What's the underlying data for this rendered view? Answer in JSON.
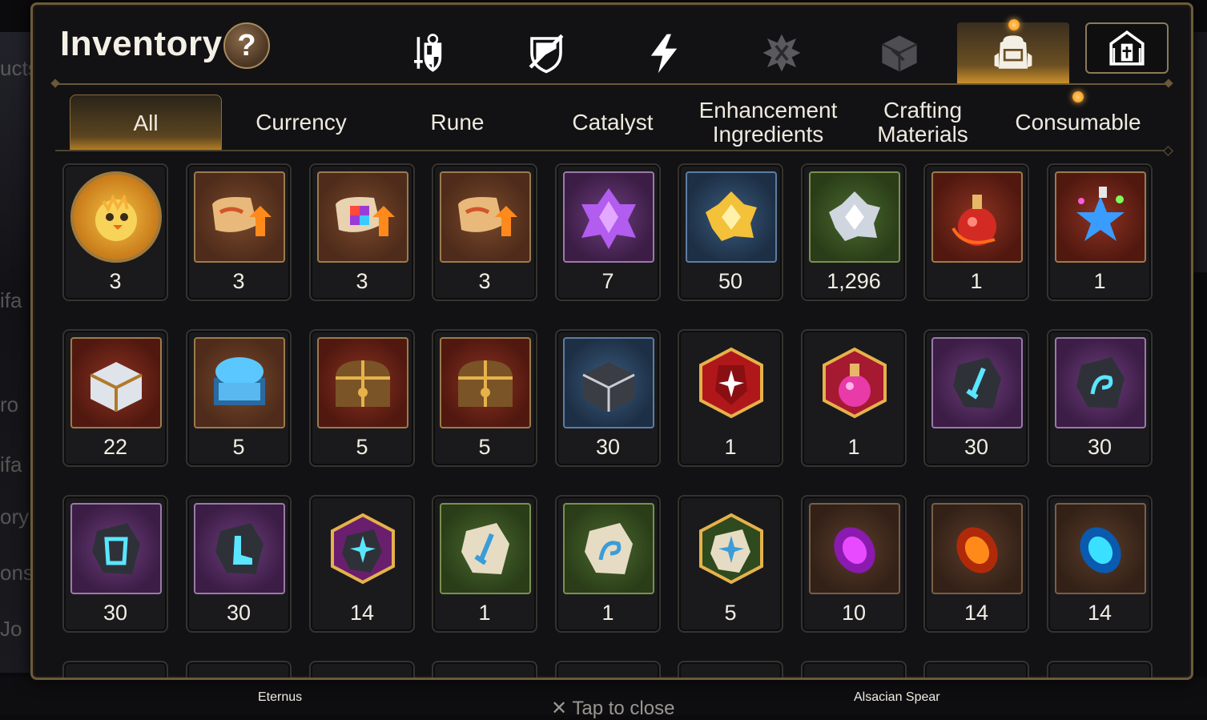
{
  "header": {
    "title": "Inventory",
    "help_label": "?"
  },
  "category_tabs": [
    {
      "name": "heroes-tab",
      "icon": "sword-shield-icon",
      "active": false
    },
    {
      "name": "artifacts-tab",
      "icon": "broken-shield-icon",
      "active": false
    },
    {
      "name": "skills-tab",
      "icon": "lightning-icon",
      "active": false
    },
    {
      "name": "specialty-tab",
      "icon": "emblem-icon",
      "active": false
    },
    {
      "name": "materials-tab",
      "icon": "cube-icon",
      "active": false
    },
    {
      "name": "inventory-tab",
      "icon": "backpack-icon",
      "active": true
    },
    {
      "name": "storage-tab",
      "icon": "castle-icon",
      "active": false
    }
  ],
  "sub_tabs": [
    {
      "label": "All",
      "active": true
    },
    {
      "label": "Currency",
      "active": false
    },
    {
      "label": "Rune",
      "active": false
    },
    {
      "label": "Catalyst",
      "active": false
    },
    {
      "label": "Enhancement Ingredients",
      "active": false
    },
    {
      "label": "Crafting Materials",
      "active": false
    },
    {
      "label": "Consumable",
      "active": false
    }
  ],
  "items": [
    {
      "icon": "chick-medal-icon",
      "count": "3"
    },
    {
      "icon": "scroll-upgrade-icon",
      "count": "3"
    },
    {
      "icon": "rainbow-scroll-upgrade-icon",
      "count": "3"
    },
    {
      "icon": "scroll-upgrade-icon",
      "count": "3"
    },
    {
      "icon": "purple-crystal-icon",
      "count": "7"
    },
    {
      "icon": "gold-crystal-icon",
      "count": "50"
    },
    {
      "icon": "silver-crystal-icon",
      "count": "1,296"
    },
    {
      "icon": "red-potion-icon",
      "count": "1"
    },
    {
      "icon": "star-potion-icon",
      "count": "1"
    },
    {
      "icon": "silver-chest-icon",
      "count": "22"
    },
    {
      "icon": "blue-chest-icon",
      "count": "5"
    },
    {
      "icon": "gold-chest-icon",
      "count": "5"
    },
    {
      "icon": "gold-chest-icon",
      "count": "5"
    },
    {
      "icon": "dark-box-icon",
      "count": "30"
    },
    {
      "icon": "red-rune-hex-icon",
      "count": "1"
    },
    {
      "icon": "pink-potion-hex-icon",
      "count": "1"
    },
    {
      "icon": "sword-rune-icon",
      "count": "30"
    },
    {
      "icon": "spiral-rune-icon",
      "count": "30"
    },
    {
      "icon": "armor-rune-icon",
      "count": "30"
    },
    {
      "icon": "boot-rune-icon",
      "count": "30"
    },
    {
      "icon": "star-rune-hex-icon",
      "count": "14"
    },
    {
      "icon": "stone-sword-rune-icon",
      "count": "1"
    },
    {
      "icon": "stone-spiral-rune-icon",
      "count": "1"
    },
    {
      "icon": "stone-star-rune-hex-icon",
      "count": "5"
    },
    {
      "icon": "purple-gem-icon",
      "count": "10"
    },
    {
      "icon": "orange-gem-icon",
      "count": "14"
    },
    {
      "icon": "blue-gem-icon",
      "count": "14"
    }
  ],
  "background": {
    "labels": [
      "Eternus",
      "Alsacian Spear"
    ],
    "close_hint": "✕ Tap to close"
  }
}
